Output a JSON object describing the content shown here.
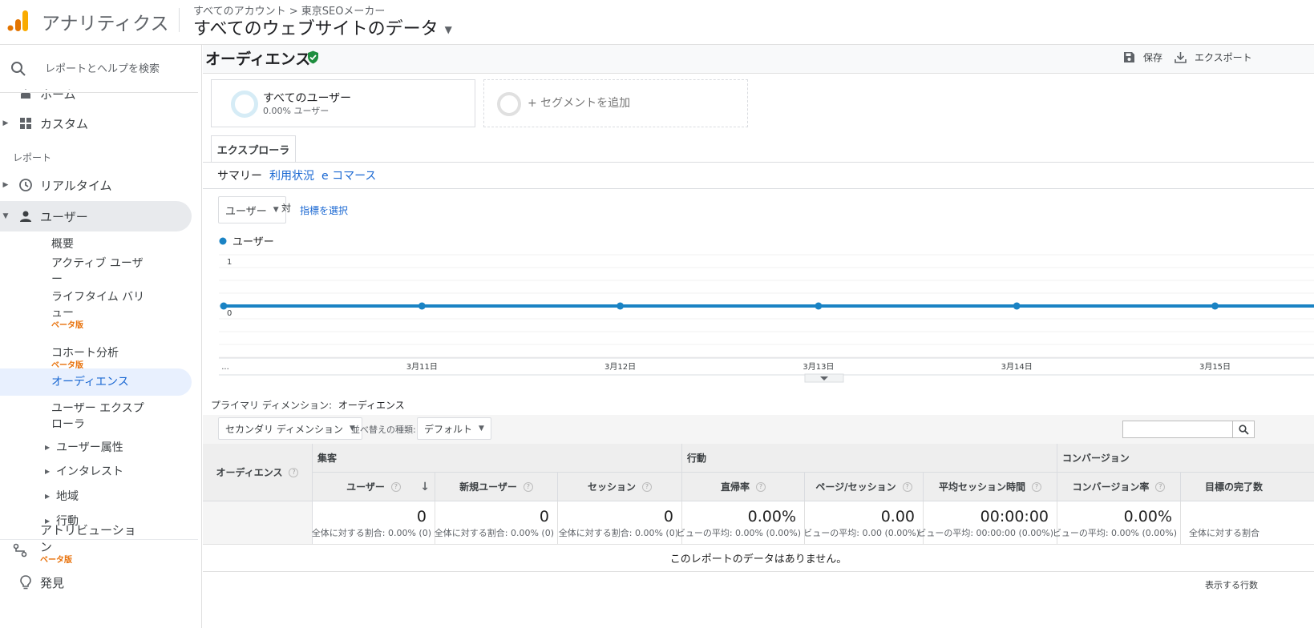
{
  "header": {
    "app_title": "アナリティクス",
    "breadcrumb": "すべてのアカウント > 東京SEOメーカー",
    "view_title": "すべてのウェブサイトのデータ"
  },
  "sidebar": {
    "search_placeholder": "レポートとヘルプを検索",
    "home": "ホーム",
    "custom": "カスタム",
    "reports_label": "レポート",
    "realtime": "リアルタイム",
    "users": "ユーザー",
    "sub_items": {
      "overview": "概要",
      "active_users_1": "アクティブ ユーザ",
      "active_users_2": "ー",
      "lifetime_1": "ライフタイム バリ",
      "lifetime_2": "ュー",
      "beta_1": "ベータ版",
      "cohort": "コホート分析",
      "beta_2": "ベータ版",
      "audience": "オーディエンス",
      "user_explorer_1": "ユーザー エクスプ",
      "user_explorer_2": "ローラ",
      "user_attr": "ユーザー属性",
      "interests": "インタレスト",
      "geo": "地域",
      "behavior": "行動"
    },
    "attribution_1": "アトリビューショ",
    "attribution_2": "ン",
    "attribution_beta": "ベータ版",
    "discover": "発見"
  },
  "page": {
    "title": "オーディエンス",
    "save": "保存",
    "export": "エクスポート"
  },
  "segments": {
    "all_users": "すべてのユーザー",
    "all_users_pct": "0.00% ユーザー",
    "add_segment": "+ セグメントを追加"
  },
  "tabs": {
    "explorer": "エクスプローラ",
    "summary": "サマリー",
    "usage": "利用状況",
    "ecommerce": "e コマース"
  },
  "metric_selector": {
    "metric": "ユーザー",
    "vs": "対",
    "select_metric": "指標を選択"
  },
  "chart_data": {
    "type": "line",
    "series": [
      {
        "name": "ユーザー",
        "values": [
          0,
          0,
          0,
          0,
          0,
          0,
          0
        ]
      }
    ],
    "x": [
      "...",
      "3月11日",
      "3月12日",
      "3月13日",
      "3月14日",
      "3月15日"
    ],
    "y_ticks": [
      "1",
      "0"
    ],
    "ylim": [
      0,
      1
    ],
    "color": "#1a83c4",
    "grid": true
  },
  "dimension": {
    "label": "プライマリ ディメンション:",
    "value": "オーディエンス"
  },
  "controls": {
    "secondary_dim": "セカンダリ ディメンション",
    "sort_label": "並べ替えの種類:",
    "sort_value": "デフォルト"
  },
  "table": {
    "dim_header": "オーディエンス",
    "groups": {
      "acquisition": "集客",
      "behavior": "行動",
      "conversion": "コンバージョン"
    },
    "columns": [
      {
        "name": "ユーザー",
        "value": "0",
        "sub": "全体に対する割合: 0.00% (0)"
      },
      {
        "name": "新規ユーザー",
        "value": "0",
        "sub": "全体に対する割合: 0.00% (0)"
      },
      {
        "name": "セッション",
        "value": "0",
        "sub": "全体に対する割合: 0.00% (0)"
      },
      {
        "name": "直帰率",
        "value": "0.00%",
        "sub": "ビューの平均: 0.00% (0.00%)"
      },
      {
        "name": "ページ/セッション",
        "value": "0.00",
        "sub": "ビューの平均: 0.00 (0.00%)"
      },
      {
        "name": "平均セッション時間",
        "value": "00:00:00",
        "sub": "ビューの平均: 00:00:00 (0.00%)"
      },
      {
        "name": "コンバージョン率",
        "value": "0.00%",
        "sub": "ビューの平均: 0.00% (0.00%)"
      },
      {
        "name": "目標の完了数",
        "value": "",
        "sub": "全体に対する割合"
      }
    ],
    "no_data": "このレポートのデータはありません。",
    "rows_label": "表示する行数"
  }
}
